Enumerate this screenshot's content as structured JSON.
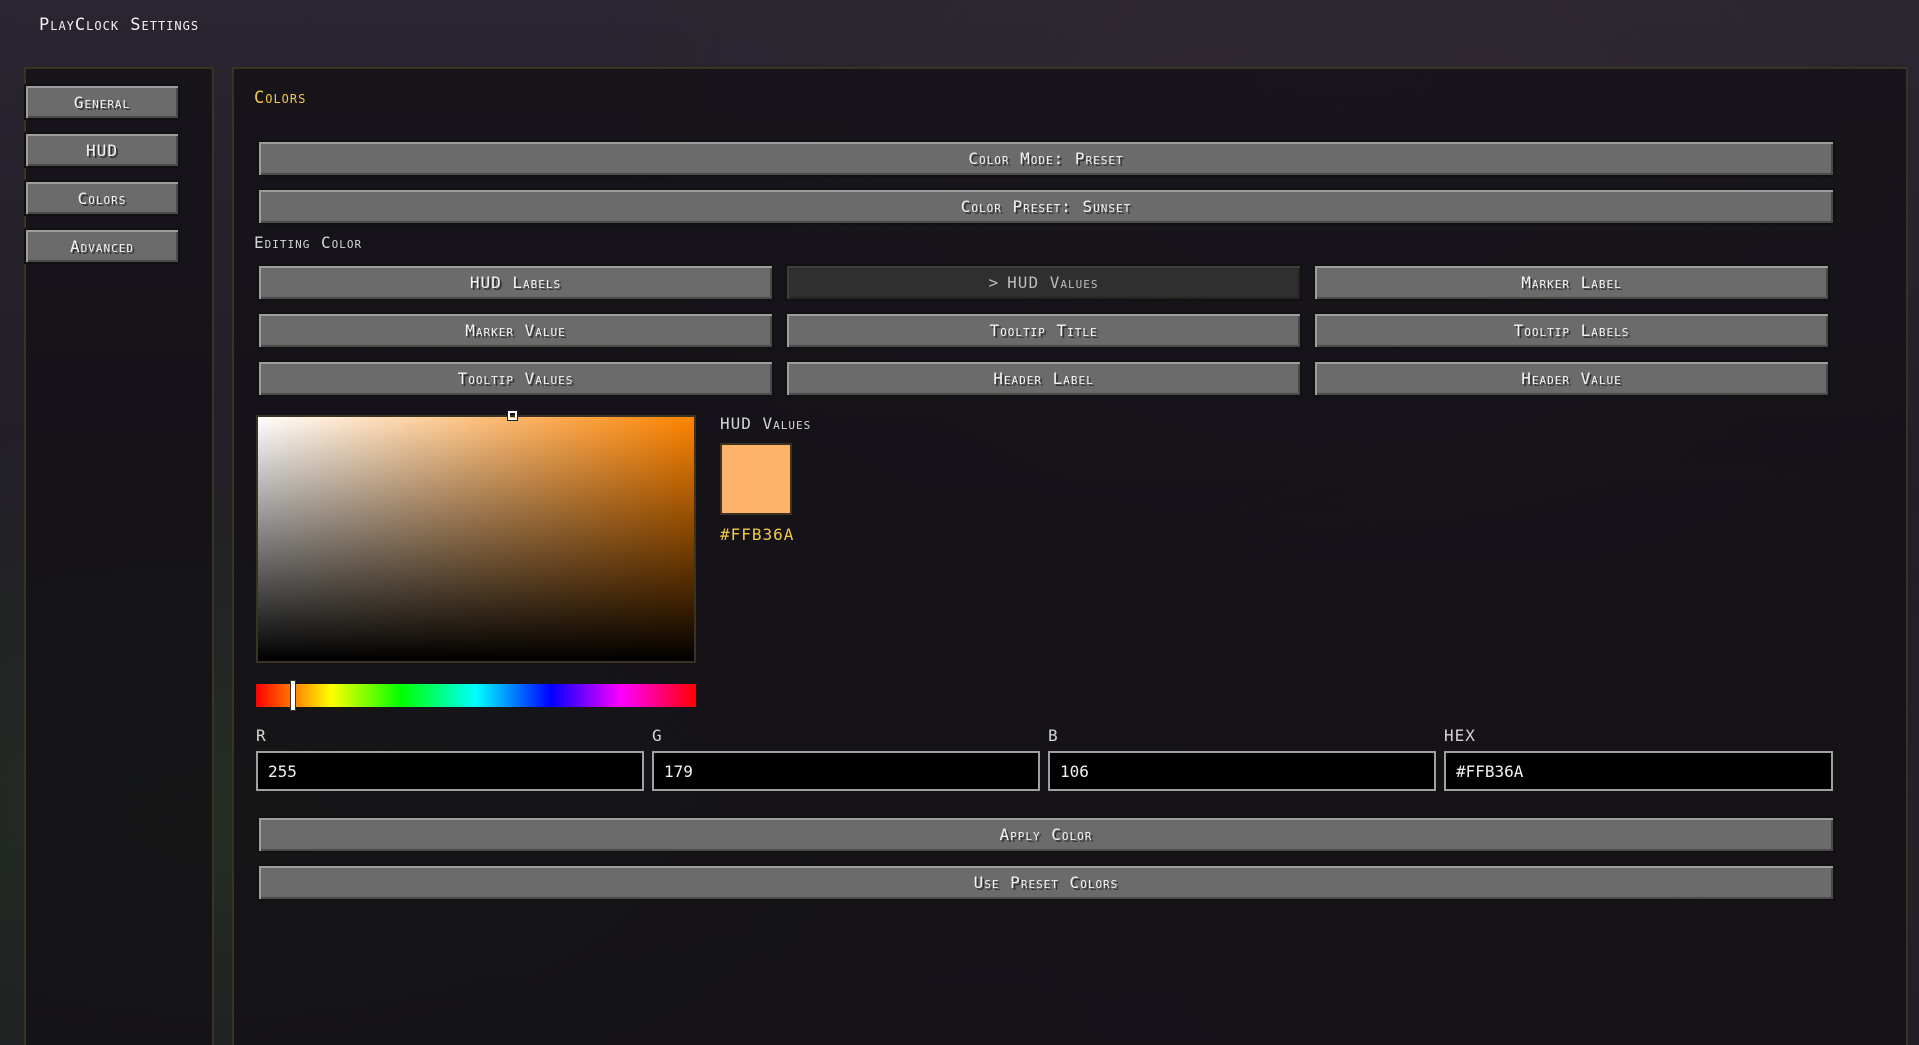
{
  "window": {
    "title": "PlayClock Settings"
  },
  "sidebar": {
    "items": [
      {
        "label": "General"
      },
      {
        "label": "HUD"
      },
      {
        "label": "Colors"
      },
      {
        "label": "Advanced"
      }
    ]
  },
  "main": {
    "section_title": "Colors",
    "color_mode_label": "Color Mode: Preset",
    "color_preset_label": "Color Preset: Sunset",
    "editing_color_label": "Editing Color",
    "targets": [
      {
        "label": "HUD Labels"
      },
      {
        "label": "HUD Values",
        "selected": true,
        "selected_glyph": ">"
      },
      {
        "label": "Marker Label"
      },
      {
        "label": "Marker Value"
      },
      {
        "label": "Tooltip Title"
      },
      {
        "label": "Tooltip Labels"
      },
      {
        "label": "Tooltip Values"
      },
      {
        "label": "Header Label"
      },
      {
        "label": "Header Value"
      }
    ],
    "picker": {
      "hue_color": "#FF8400",
      "saturation": 0.58,
      "value": 1.0,
      "hue_position": 0.07
    },
    "preview": {
      "label": "HUD Values",
      "color": "#FFB36A",
      "hex": "#FFB36A"
    },
    "fields": {
      "r": {
        "label": "R",
        "value": "255"
      },
      "g": {
        "label": "G",
        "value": "179"
      },
      "b": {
        "label": "B",
        "value": "106"
      },
      "hex": {
        "label": "HEX",
        "value": "#FFB36A"
      }
    },
    "apply_label": "Apply Color",
    "use_preset_label": "Use Preset Colors"
  }
}
